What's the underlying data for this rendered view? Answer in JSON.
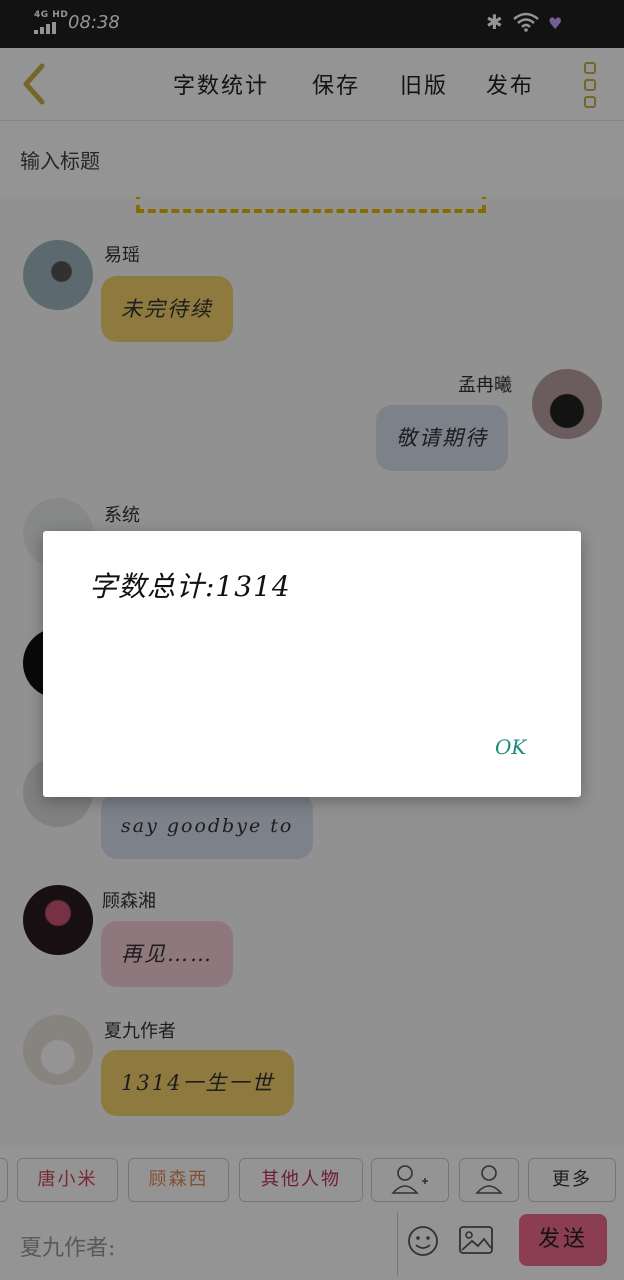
{
  "status_bar": {
    "network": "4G HD",
    "time": "08:38"
  },
  "toolbar": {
    "word_count": "字数统计",
    "save": "保存",
    "old_version": "旧版",
    "publish": "发布"
  },
  "title_input": {
    "placeholder": "输入标题"
  },
  "messages": [
    {
      "name": "易瑶",
      "text": "未完待续"
    },
    {
      "name": "孟冉曦",
      "text": "敬请期待"
    },
    {
      "name": "系统",
      "text": ""
    },
    {
      "name": "",
      "text": "say goodbye to"
    },
    {
      "name": "顾森湘",
      "text": "再见……"
    },
    {
      "name": "夏九作者",
      "text": "1314一生一世"
    }
  ],
  "dialog": {
    "message": "字数总计:1314",
    "ok": "OK"
  },
  "characters": [
    "唐小米",
    "顾森西",
    "其他人物"
  ],
  "more": "更多",
  "composer": {
    "prefix": "夏九作者:",
    "send": "发送"
  }
}
